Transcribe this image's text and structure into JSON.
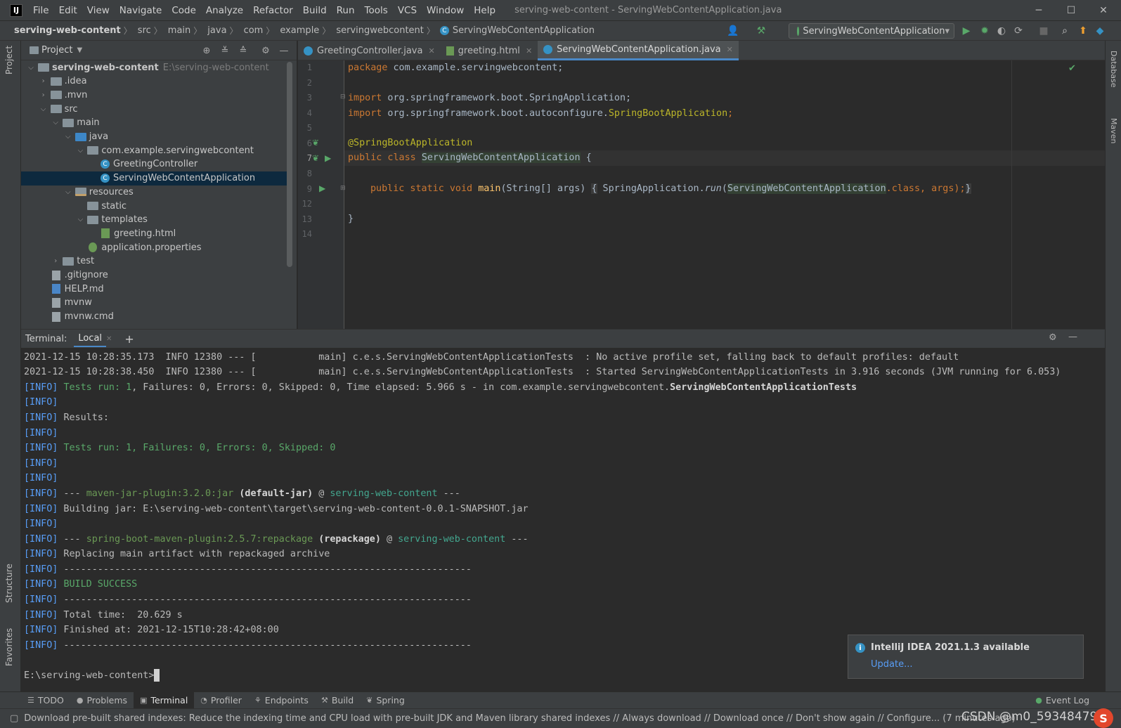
{
  "window": {
    "logo": "IJ",
    "title": "serving-web-content - ServingWebContentApplication.java",
    "minimize": "─",
    "maximize": "☐",
    "close": "✕"
  },
  "menu": [
    "File",
    "Edit",
    "View",
    "Navigate",
    "Code",
    "Analyze",
    "Refactor",
    "Build",
    "Run",
    "Tools",
    "VCS",
    "Window",
    "Help"
  ],
  "breadcrumb": [
    "serving-web-content",
    "src",
    "main",
    "java",
    "com",
    "example",
    "servingwebcontent",
    "ServingWebContentApplication"
  ],
  "run_config": "ServingWebContentApplication",
  "left_strip": {
    "project": "Project",
    "structure": "Structure",
    "favorites": "Favorites"
  },
  "right_strip": {
    "database": "Database",
    "maven": "Maven"
  },
  "project_panel": {
    "title": "Project",
    "tree": [
      {
        "label": "serving-web-content",
        "hint": "E:\\serving-web-content",
        "icon": "folder",
        "arrow": "⌄",
        "indent": 0
      },
      {
        "label": ".idea",
        "icon": "folder",
        "arrow": "›",
        "indent": 1
      },
      {
        "label": ".mvn",
        "icon": "folder",
        "arrow": "›",
        "indent": 1
      },
      {
        "label": "src",
        "icon": "folder",
        "arrow": "⌄",
        "indent": 1
      },
      {
        "label": "main",
        "icon": "folder",
        "arrow": "⌄",
        "indent": 2
      },
      {
        "label": "java",
        "icon": "folder-blue",
        "arrow": "⌄",
        "indent": 3
      },
      {
        "label": "com.example.servingwebcontent",
        "icon": "folder",
        "arrow": "⌄",
        "indent": 4
      },
      {
        "label": "GreetingController",
        "icon": "class",
        "arrow": "",
        "indent": 5
      },
      {
        "label": "ServingWebContentApplication",
        "icon": "class",
        "arrow": "",
        "indent": 5
      },
      {
        "label": "resources",
        "icon": "folder-res",
        "arrow": "⌄",
        "indent": 3
      },
      {
        "label": "static",
        "icon": "folder",
        "arrow": "",
        "indent": 4
      },
      {
        "label": "templates",
        "icon": "folder",
        "arrow": "⌄",
        "indent": 4
      },
      {
        "label": "greeting.html",
        "icon": "html",
        "arrow": "",
        "indent": 5
      },
      {
        "label": "application.properties",
        "icon": "props",
        "arrow": "",
        "indent": 4
      },
      {
        "label": "test",
        "icon": "folder",
        "arrow": "›",
        "indent": 2
      },
      {
        "label": ".gitignore",
        "icon": "file",
        "arrow": "",
        "indent": 1
      },
      {
        "label": "HELP.md",
        "icon": "md",
        "arrow": "",
        "indent": 1
      },
      {
        "label": "mvnw",
        "icon": "file",
        "arrow": "",
        "indent": 1
      },
      {
        "label": "mvnw.cmd",
        "icon": "file",
        "arrow": "",
        "indent": 1
      }
    ]
  },
  "editor_tabs": [
    {
      "label": "GreetingController.java",
      "type": "class",
      "active": false
    },
    {
      "label": "greeting.html",
      "type": "html",
      "active": false
    },
    {
      "label": "ServingWebContentApplication.java",
      "type": "class",
      "active": true
    }
  ],
  "editor": {
    "line_numbers": [
      "1",
      "2",
      "3",
      "4",
      "5",
      "6",
      "7",
      "8",
      "9",
      "12",
      "13",
      "14"
    ],
    "current_line": "7",
    "code": {
      "l1_kw": "package",
      "l1_rest": " com.example.servingwebcontent;",
      "l3_kw": "import",
      "l3_rest": " org.springframework.boot.SpringApplication;",
      "l4_kw": "import",
      "l4_pre": " org.springframework.boot.autoconfigure.",
      "l4_cls": "SpringBootApplication",
      "l4_end": ";",
      "l6_ann": "@SpringBootApplication",
      "l7_kw": "public class",
      "l7_cls": "ServingWebContentApplication",
      "l7_end": " {",
      "l9_kw": "public static void",
      "l9_fn": "main",
      "l9_args": "(String[] args)",
      "l9_open": "{",
      "l9_call": " SpringApplication.",
      "l9_run": "run",
      "l9_paren": "(",
      "l9_arg": "ServingWebContentApplication",
      "l9_cls": ".class",
      "l9_tail": ", args);",
      "l9_close": "}",
      "l13": "}"
    }
  },
  "terminal": {
    "header_label": "Terminal:",
    "tab": "Local",
    "add": "+",
    "lines": {
      "t1": "2021-12-15 10:28:35.173  INFO 12380 --- [           main] c.e.s.ServingWebContentApplicationTests  : No active profile set, falling back to default profiles: default",
      "t2": "2021-12-15 10:28:38.450  INFO 12380 --- [           main] c.e.s.ServingWebContentApplicationTests  : Started ServingWebContentApplicationTests in 3.916 seconds (JVM running for 6.053)",
      "t3_tests": "Tests run: 1",
      "t3_mid": ", Failures: 0, Errors: 0, Skipped: 0, Time elapsed: 5.966 s - in com.example.servingwebcontent.",
      "t3_bold": "ServingWebContentApplicationTests",
      "t5": "Results:",
      "t7": "Tests run: 1, Failures: 0, Errors: 0, Skipped: 0",
      "t10_pre": " --- ",
      "t10_plugin": "maven-jar-plugin:3.2.0:jar",
      "t10_goal": " (default-jar)",
      "t10_at": " @ ",
      "t10_proj": "serving-web-content",
      "t10_end": " ---",
      "t11": " Building jar: E:\\serving-web-content\\target\\serving-web-content-0.0.1-SNAPSHOT.jar",
      "t13_pre": " --- ",
      "t13_plugin": "spring-boot-maven-plugin:2.5.7:repackage",
      "t13_goal": " (repackage)",
      "t13_at": " @ ",
      "t13_proj": "serving-web-content",
      "t13_end": " ---",
      "t14": " Replacing main artifact with repackaged archive",
      "dash": " ------------------------------------------------------------------------",
      "t16": "BUILD SUCCESS",
      "t18": " Total time:  20.629 s",
      "t19": " Finished at: 2021-12-15T10:28:42+08:00",
      "prompt": "E:\\serving-web-content>"
    },
    "info_tag": "[INFO]"
  },
  "notification": {
    "title": "IntelliJ IDEA 2021.1.3 available",
    "link": "Update..."
  },
  "bottom_tools": [
    {
      "label": "TODO",
      "icon": "☰",
      "active": false
    },
    {
      "label": "Problems",
      "icon": "●",
      "active": false
    },
    {
      "label": "Terminal",
      "icon": "▣",
      "active": true
    },
    {
      "label": "Profiler",
      "icon": "◔",
      "active": false
    },
    {
      "label": "Endpoints",
      "icon": "⚘",
      "active": false
    },
    {
      "label": "Build",
      "icon": "⚒",
      "active": false
    },
    {
      "label": "Spring",
      "icon": "❦",
      "active": false
    }
  ],
  "event_log": "Event Log",
  "status_message": "Download pre-built shared indexes: Reduce the indexing time and CPU load with pre-built JDK and Maven library shared indexes // Always download // Download once // Don't show again // Configure... (7 minutes ago)",
  "watermark": "CSDN @m0_59348479",
  "colors": {
    "accent": "#4a88c7",
    "info": "#589df6",
    "success": "#59a869",
    "keyword": "#cc7832",
    "annotation": "#bbb529"
  }
}
